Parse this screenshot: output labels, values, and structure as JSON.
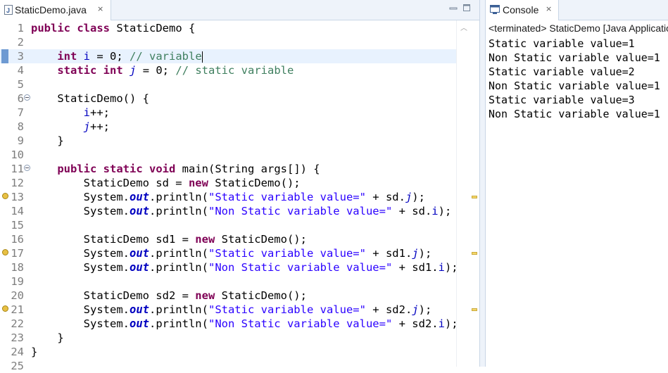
{
  "editor": {
    "tab_title": "StaticDemo.java",
    "close_glyph": "×",
    "minimize_glyph": "▭",
    "maximize_glyph": "□",
    "lines": [
      "public class StaticDemo {",
      "",
      "    int i = 0; // variable",
      "    static int j = 0; // static variable",
      "",
      "    StaticDemo() {",
      "        i++;",
      "        j++;",
      "    }",
      "",
      "    public static void main(String args[]) {",
      "        StaticDemo sd = new StaticDemo();",
      "        System.out.println(\"Static variable value=\" + sd.j);",
      "        System.out.println(\"Non Static variable value=\" + sd.i);",
      "",
      "        StaticDemo sd1 = new StaticDemo();",
      "        System.out.println(\"Static variable value=\" + sd1.j);",
      "        System.out.println(\"Non Static variable value=\" + sd1.i);",
      "",
      "        StaticDemo sd2 = new StaticDemo();",
      "        System.out.println(\"Static variable value=\" + sd2.j);",
      "        System.out.println(\"Non Static variable value=\" + sd2.i);",
      "    }",
      "}",
      ""
    ],
    "line_numbers": [
      "1",
      "2",
      "3",
      "4",
      "5",
      "6",
      "7",
      "8",
      "9",
      "10",
      "11",
      "12",
      "13",
      "14",
      "15",
      "16",
      "17",
      "18",
      "19",
      "20",
      "21",
      "22",
      "23",
      "24",
      "25"
    ],
    "current_line": 3,
    "warning_lines": [
      13,
      17,
      21
    ],
    "fold_lines": [
      6,
      11
    ]
  },
  "console": {
    "tab_title": "Console",
    "close_glyph": "×",
    "status": "<terminated> StaticDemo [Java Application]",
    "output": [
      "Static variable value=1",
      "Non Static variable value=1",
      "Static variable value=2",
      "Non Static variable value=1",
      "Static variable value=3",
      "Non Static variable value=1"
    ]
  },
  "colors": {
    "keyword": "#7f0055",
    "comment": "#3f7f5f",
    "string": "#2a00ff",
    "field": "#0000c0",
    "current_line_bg": "#e8f2fe"
  },
  "icons": {
    "editor_tab": "java-file-icon",
    "console_tab": "console-icon",
    "warning": "warning-icon",
    "fold": "fold-collapse-icon"
  }
}
